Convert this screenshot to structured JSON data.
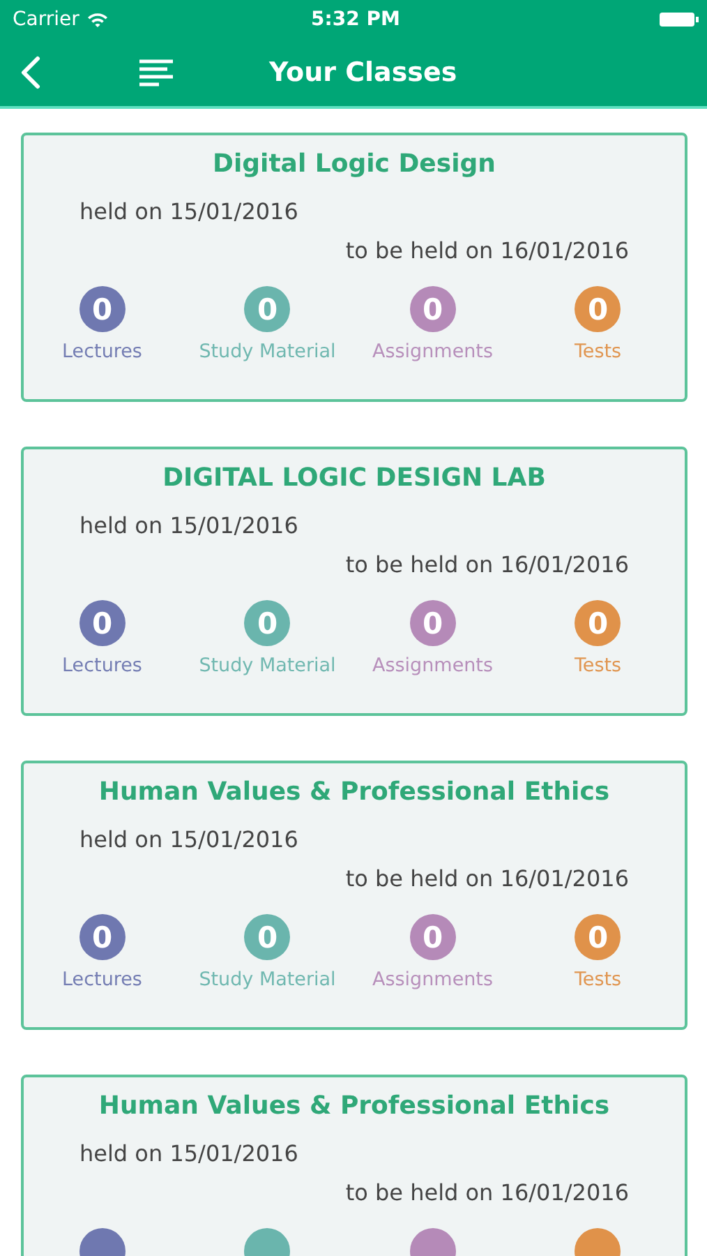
{
  "status_bar": {
    "carrier": "Carrier",
    "time": "5:32 PM"
  },
  "nav": {
    "title": "Your Classes"
  },
  "classes": [
    {
      "name": "Digital Logic Design",
      "held": "held on 15/01/2016",
      "next": "to be held on 16/01/2016",
      "stats": [
        {
          "count": "0",
          "label": "Lectures",
          "color": "#6f78b0"
        },
        {
          "count": "0",
          "label": "Study Material",
          "color": "#6ab5ad"
        },
        {
          "count": "0",
          "label": "Assignments",
          "color": "#b58ab8"
        },
        {
          "count": "0",
          "label": "Tests",
          "color": "#e0924a"
        }
      ]
    },
    {
      "name": "DIGITAL LOGIC DESIGN LAB",
      "held": "held on 15/01/2016",
      "next": "to be held on 16/01/2016",
      "stats": [
        {
          "count": "0",
          "label": "Lectures",
          "color": "#6f78b0"
        },
        {
          "count": "0",
          "label": "Study Material",
          "color": "#6ab5ad"
        },
        {
          "count": "0",
          "label": "Assignments",
          "color": "#b58ab8"
        },
        {
          "count": "0",
          "label": "Tests",
          "color": "#e0924a"
        }
      ]
    },
    {
      "name": "Human Values & Professional Ethics",
      "held": "held on 15/01/2016",
      "next": "to be held on 16/01/2016",
      "stats": [
        {
          "count": "0",
          "label": "Lectures",
          "color": "#6f78b0"
        },
        {
          "count": "0",
          "label": "Study Material",
          "color": "#6ab5ad"
        },
        {
          "count": "0",
          "label": "Assignments",
          "color": "#b58ab8"
        },
        {
          "count": "0",
          "label": "Tests",
          "color": "#e0924a"
        }
      ]
    },
    {
      "name": "Human Values & Professional Ethics",
      "held": "held on 15/01/2016",
      "next": "to be held on 16/01/2016",
      "stats": [
        {
          "color": "#6f78b0"
        },
        {
          "color": "#6ab5ad"
        },
        {
          "color": "#b58ab8"
        },
        {
          "color": "#e0924a"
        }
      ]
    }
  ]
}
